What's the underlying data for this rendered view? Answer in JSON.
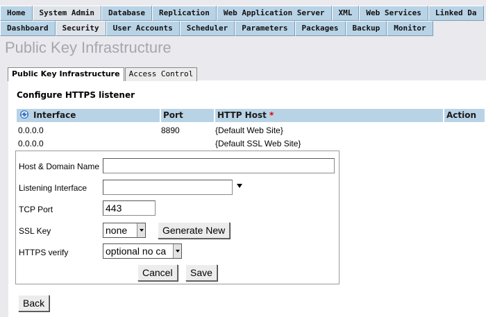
{
  "nav": {
    "row1": [
      "Home",
      "System Admin",
      "Database",
      "Replication",
      "Web Application Server",
      "XML",
      "Web Services",
      "Linked Da"
    ],
    "row1_active": 1,
    "row2": [
      "Dashboard",
      "Security",
      "User Accounts",
      "Scheduler",
      "Parameters",
      "Packages",
      "Backup",
      "Monitor"
    ],
    "row2_active": 1
  },
  "page_title": "Public Key Infrastructure",
  "subtabs": [
    {
      "label": "Public Key Infrastructure",
      "active": true
    },
    {
      "label": "Access Control",
      "active": false
    }
  ],
  "section_title": "Configure HTTPS listener",
  "table": {
    "headers": {
      "interface": "Interface",
      "port": "Port",
      "http_host": "HTTP Host",
      "required_mark": "*",
      "action": "Action"
    },
    "rows": [
      {
        "interface": "0.0.0.0",
        "port": "8890",
        "host": "{Default Web Site}"
      },
      {
        "interface": "0.0.0.0",
        "port": "",
        "host": "{Default SSL Web Site}"
      }
    ]
  },
  "form": {
    "host_label": "Host & Domain Name",
    "host_value": "",
    "interface_label": "Listening Interface",
    "interface_value": "",
    "port_label": "TCP Port",
    "port_value": "443",
    "sslkey_label": "SSL Key",
    "sslkey_value": "none",
    "generate_label": "Generate New",
    "verify_label": "HTTPS verify",
    "verify_value": "optional no ca",
    "cancel_label": "Cancel",
    "save_label": "Save"
  },
  "back_label": "Back",
  "colors": {
    "tab_bg": "#b9d3e6",
    "title_gray": "#a6a6ad",
    "required": "#d00000"
  }
}
